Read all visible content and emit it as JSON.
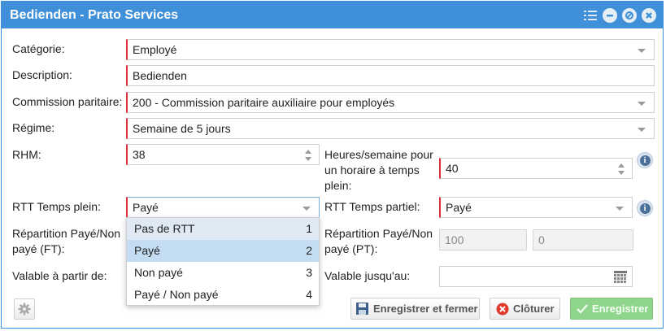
{
  "window": {
    "title": "Bedienden - Prato Services"
  },
  "form": {
    "categorie": {
      "label": "Catégorie:",
      "value": "Employé"
    },
    "description": {
      "label": "Description:",
      "value": "Bedienden"
    },
    "commission": {
      "label": "Commission paritaire:",
      "value": "200 - Commission paritaire auxiliaire pour employés"
    },
    "regime": {
      "label": "Régime:",
      "value": "Semaine de 5 jours"
    },
    "rhm": {
      "label": "RHM:",
      "value": "38"
    },
    "heures": {
      "label_line1": "Heures/semaine pour",
      "label_line2": "un horaire à temps",
      "label_line3": "plein:",
      "value": "40"
    },
    "rtt_plein": {
      "label": "RTT Temps plein:",
      "value": "Payé"
    },
    "rtt_partiel": {
      "label": "RTT Temps partiel:",
      "value": "Payé"
    },
    "repartition_ft": {
      "label_line1": "Répartition Payé/Non",
      "label_line2": "payé (FT):"
    },
    "repartition_pt": {
      "label_line1": "Répartition Payé/Non",
      "label_line2": "payé (PT):",
      "value1": "100",
      "value2": "0"
    },
    "valable_partir": {
      "label": "Valable à partir de:"
    },
    "valable_jusqu": {
      "label": "Valable jusqu'au:"
    }
  },
  "dropdown": {
    "items": [
      {
        "label": "Pas de RTT",
        "num": "1"
      },
      {
        "label": "Payé",
        "num": "2"
      },
      {
        "label": "Non payé",
        "num": "3"
      },
      {
        "label": "Payé / Non payé",
        "num": "4"
      }
    ],
    "selected_index": 1
  },
  "buttons": {
    "save_close": "Enregistrer et fermer",
    "close": "Clôturer",
    "save": "Enregistrer"
  },
  "colors": {
    "titlebar": "#3f90d8",
    "required": "#e0303b",
    "primary": "#8fd58c"
  }
}
